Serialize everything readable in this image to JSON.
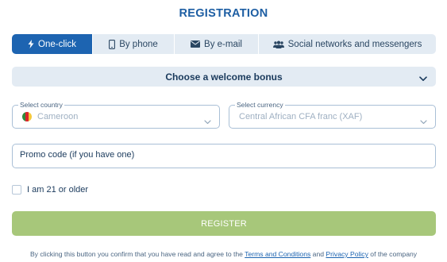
{
  "title": "REGISTRATION",
  "tabs": [
    {
      "label": "One-click",
      "icon": "lightning-icon",
      "active": true
    },
    {
      "label": "By phone",
      "icon": "phone-icon",
      "active": false
    },
    {
      "label": "By e-mail",
      "icon": "envelope-icon",
      "active": false
    },
    {
      "label": "Social networks and messengers",
      "icon": "users-icon",
      "active": false
    }
  ],
  "bonus": {
    "label": "Choose a welcome bonus"
  },
  "country": {
    "legend": "Select country",
    "value": "Cameroon"
  },
  "currency": {
    "legend": "Select currency",
    "value": "Central African CFA franc (XAF)"
  },
  "promo": {
    "placeholder": "Promo code (if you have one)"
  },
  "age": {
    "label": "I am 21 or older",
    "checked": false
  },
  "register": {
    "label": "REGISTER"
  },
  "legal": {
    "prefix": "By clicking this button you confirm that you have read and agree to the ",
    "terms_link": "Terms and Conditions",
    "middle": " and ",
    "privacy_link": "Privacy Policy",
    "suffix": " of the company"
  },
  "colors": {
    "accent": "#1d64b1",
    "tab_bg": "#e3ebf3",
    "register_bg": "#a7c77a",
    "border": "#a9bfd6"
  }
}
